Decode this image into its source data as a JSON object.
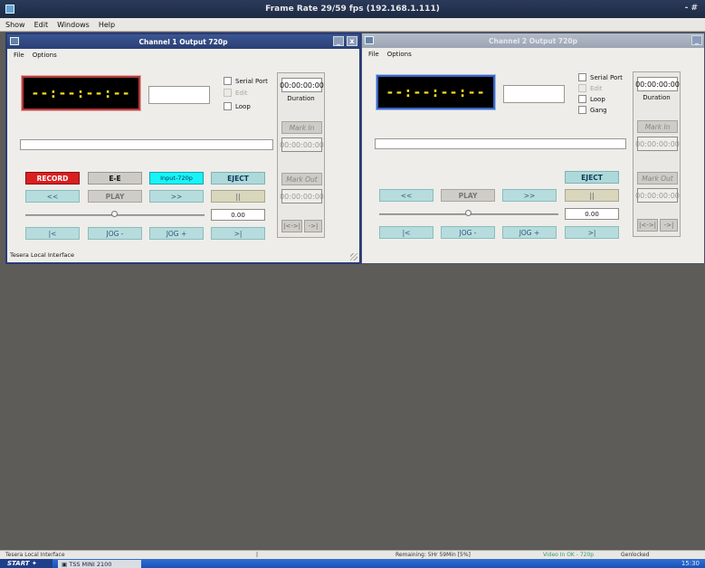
{
  "app": {
    "title": "Frame Rate 29/59 fps  (192.168.1.111)",
    "window_controls": "- #",
    "menu": [
      "Show",
      "Edit",
      "Windows",
      "Help"
    ]
  },
  "channel1": {
    "title": "Channel  1  Output 720p",
    "menu": [
      "File",
      "Options"
    ],
    "timecode": "--:--:--:--",
    "checks": {
      "serial": "Serial Port",
      "edit": "Edit",
      "loop": "Loop"
    },
    "duration_value": "00:00:00:00",
    "duration_label": "Duration",
    "mark_in": "Mark In",
    "mark_in_value": "00:00:00:00",
    "mark_out": "Mark Out",
    "mark_out_value": "00:00:00:00",
    "left_btn": "|<->|",
    "right_btn": "->|",
    "speed": "0.00",
    "buttons": {
      "record": "RECORD",
      "ee": "E-E",
      "input": "Input-720p",
      "eject": "EJECT",
      "rew": "<<",
      "play": "PLAY",
      "ffwd": ">>",
      "pause": "||",
      "start": "|<",
      "jog_minus": "JOG -",
      "jog_plus": "JOG +",
      "end": ">|"
    },
    "status": "Tesera Local Interface",
    "win_min": "_",
    "win_close": "x"
  },
  "channel2": {
    "title": "Channel  2  Output 720p",
    "menu": [
      "File",
      "Options"
    ],
    "timecode": "--:--:--:--",
    "checks": {
      "serial": "Serial Port",
      "edit": "Edit",
      "loop": "Loop",
      "gang": "Gang"
    },
    "duration_value": "00:00:00:00",
    "duration_label": "Duration",
    "mark_in": "Mark In",
    "mark_in_value": "00:00:00:00",
    "mark_out": "Mark Out",
    "mark_out_value": "00:00:00:00",
    "left_btn": "|<->|",
    "right_btn": "->|",
    "speed": "0.00",
    "buttons": {
      "eject": "EJECT",
      "rew": "<<",
      "play": "PLAY",
      "ffwd": ">>",
      "pause": "||",
      "start": "|<",
      "jog_minus": "JOG -",
      "jog_plus": "JOG +",
      "end": ">|"
    },
    "win_min": "_"
  },
  "statusbar": {
    "interface": "Tesera Local Interface",
    "remaining": "Remaining: 5Hr 59Min  [5%]",
    "video_in": "Video In OK - 720p",
    "genlock": "Genlocked"
  },
  "taskbar": {
    "start": "START",
    "task": "TSS MINI 2100",
    "clock": "15:30"
  }
}
